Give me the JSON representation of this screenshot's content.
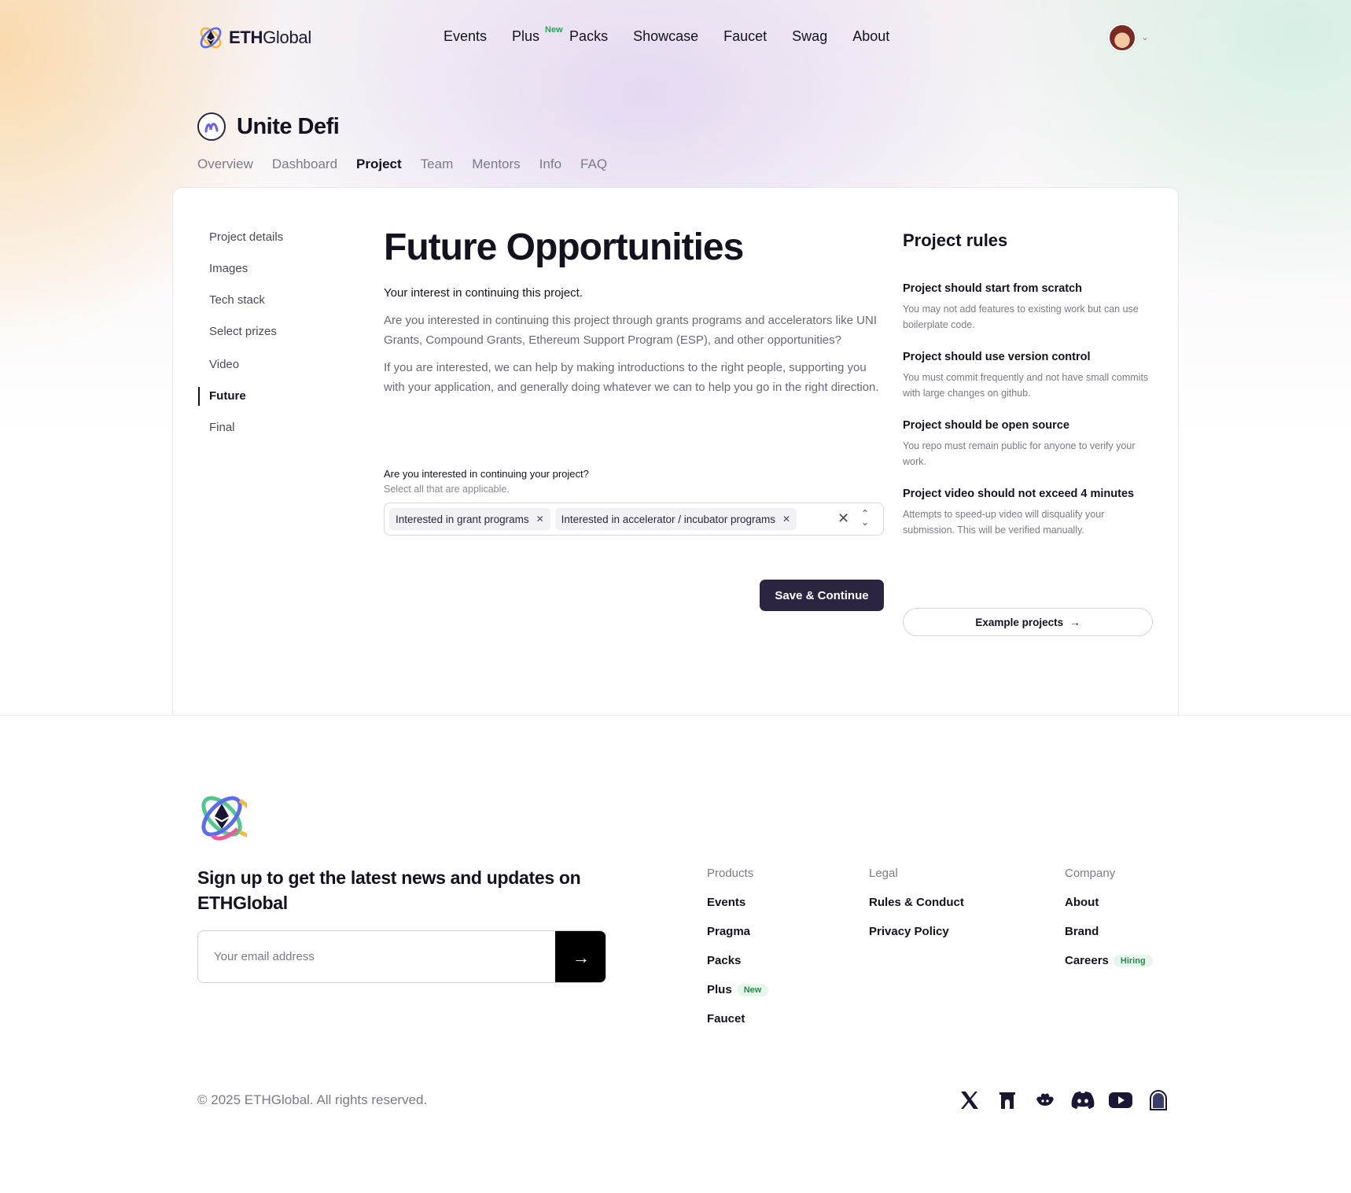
{
  "brand": {
    "name_bold": "ETH",
    "name_light": "Global"
  },
  "topnav": {
    "links": [
      "Events",
      "Plus",
      "Packs",
      "Showcase",
      "Faucet",
      "Swag",
      "About"
    ],
    "plus_badge": "New"
  },
  "event": {
    "title": "Unite Defi",
    "tabs": [
      "Overview",
      "Dashboard",
      "Project",
      "Team",
      "Mentors",
      "Info",
      "FAQ"
    ],
    "active_tab": "Project"
  },
  "sidenav": {
    "items": [
      "Project details",
      "Images",
      "Tech stack",
      "Select prizes",
      "Video",
      "Future",
      "Final"
    ],
    "active": "Future"
  },
  "main": {
    "title": "Future Opportunities",
    "lead": "Your interest in continuing this project.",
    "para1": "Are you interested in continuing this project through grants programs and accelerators like UNI Grants, Compound Grants, Ethereum Support Program (ESP), and other opportunities?",
    "para2": "If you are interested, we can help by making introductions to the right people, supporting you with your application, and generally doing whatever we can to help you go in the right direction.",
    "field_label": "Are you interested in continuing your project?",
    "field_help": "Select all that are applicable.",
    "chips": [
      "Interested in grant programs",
      "Interested in accelerator / incubator programs"
    ],
    "save_label": "Save & Continue"
  },
  "rules": {
    "title": "Project rules",
    "items": [
      {
        "title": "Project should start from scratch",
        "desc": "You may not add features to existing work but can use boilerplate code."
      },
      {
        "title": "Project should use version control",
        "desc": "You must commit frequently and not have small commits with large changes on github."
      },
      {
        "title": "Project should be open source",
        "desc": "You repo must remain public for anyone to verify your work."
      },
      {
        "title": "Project video should not exceed 4 minutes",
        "desc": "Attempts to speed-up video will disqualify your submission. This will be verified manually."
      }
    ],
    "example_label": "Example projects"
  },
  "footer": {
    "newsletter_title": "Sign up to get the latest news and updates on ETHGlobal",
    "email_placeholder": "Your email address",
    "columns": {
      "products": {
        "heading": "Products",
        "links": [
          "Events",
          "Pragma",
          "Packs",
          "Plus",
          "Faucet"
        ],
        "plus_badge": "New"
      },
      "legal": {
        "heading": "Legal",
        "links": [
          "Rules & Conduct",
          "Privacy Policy"
        ]
      },
      "company": {
        "heading": "Company",
        "links": [
          "About",
          "Brand",
          "Careers"
        ],
        "careers_badge": "Hiring"
      }
    },
    "copyright": "© 2025 ETHGlobal. All rights reserved.",
    "socials": [
      "x-icon",
      "farcaster-icon",
      "lens-icon",
      "discord-icon",
      "youtube-icon",
      "mirror-icon"
    ]
  },
  "colors": {
    "primary": "#2c2541",
    "text": "#14121f",
    "muted": "#7c7a86",
    "badge_green": "#2aa35a"
  }
}
